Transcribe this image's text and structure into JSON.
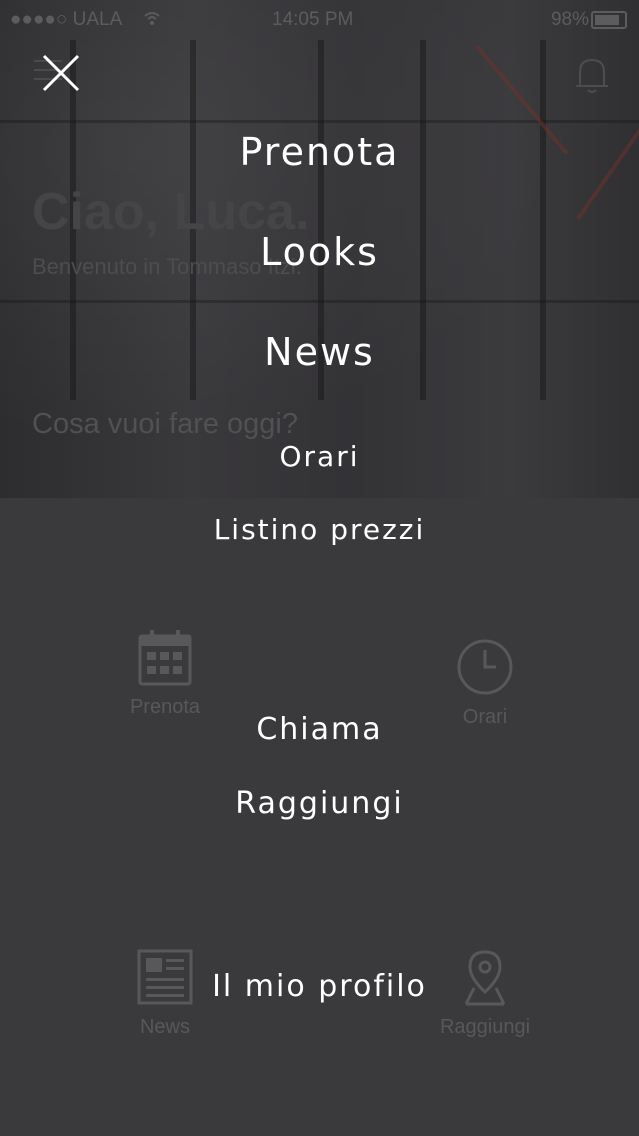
{
  "status_bar": {
    "carrier": "●●●●○ UALA",
    "time": "14:05 PM",
    "battery": "98%"
  },
  "background": {
    "greeting": "Ciao, Luca.",
    "welcome": "Benvenuto in Tommaso Itzi.",
    "question": "Cosa vuoi fare oggi?",
    "tiles": {
      "prenota": "Prenota",
      "orari": "Orari",
      "news": "News",
      "raggiungi": "Raggiungi"
    }
  },
  "menu": {
    "items": [
      {
        "label": "Prenota"
      },
      {
        "label": "Looks"
      },
      {
        "label": "News"
      },
      {
        "label": "Orari"
      },
      {
        "label": "Listino prezzi"
      },
      {
        "label": "Chiama"
      },
      {
        "label": "Raggiungi"
      },
      {
        "label": "Il mio profilo"
      }
    ]
  },
  "colors": {
    "overlay_bg": "#3a393c",
    "menu_text": "#ffffff",
    "dim_text": "#58575a"
  },
  "icons": {
    "close": "close-icon",
    "menu": "hamburger-icon",
    "notifications": "bell-icon"
  }
}
